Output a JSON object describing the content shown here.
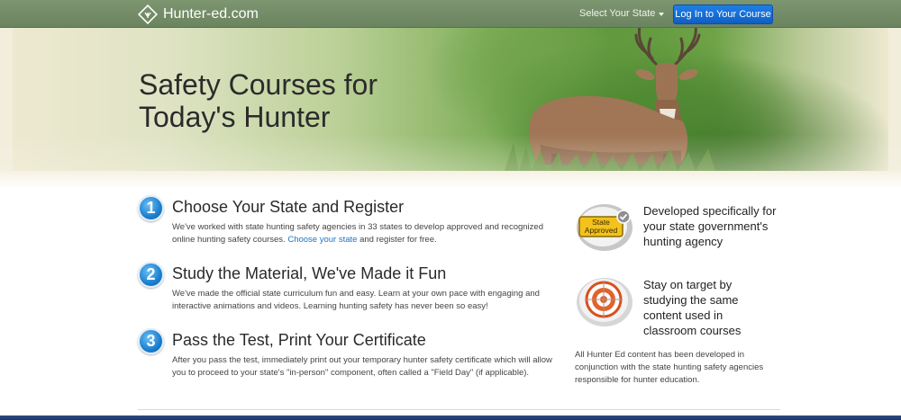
{
  "nav": {
    "logo_text": "Hunter-ed.com",
    "state_select_label": "Select Your State",
    "login_label": "Log In to Your Course"
  },
  "hero": {
    "title_line1": "Safety Courses for",
    "title_line2": "Today's Hunter"
  },
  "steps": [
    {
      "number": "1",
      "title": "Choose Your State and Register",
      "body_before": "We've worked with state hunting safety agencies in 33 states to develop approved and recognized online hunting safety courses. ",
      "link": "Choose your state",
      "body_after": " and register for free."
    },
    {
      "number": "2",
      "title": "Study the Material, We've Made it Fun",
      "body": "We've made the official state curriculum fun and easy. Learn at your own pace with engaging and interactive animations and videos. Learning hunting safety has never been so easy!"
    },
    {
      "number": "3",
      "title": "Pass the Test, Print Your Certificate",
      "body": "After you pass the test, immediately print out your temporary hunter safety certificate which will allow you to proceed to your state's \"in-person\" component, often called a \"Field Day\" (if applicable)."
    }
  ],
  "features": [
    {
      "icon": "state-approved-badge-icon",
      "badge_line1": "State",
      "badge_line2": "Approved",
      "text": "Developed specifically for your state government's hunting agency"
    },
    {
      "icon": "target-icon",
      "text": "Stay on target by studying the same content used in classroom courses"
    }
  ],
  "note": "All Hunter Ed content has been developed in conjunction with the state hunting safety agencies responsible for hunter education.",
  "colors": {
    "nav_bg": "#738d67",
    "login_button": "#1570d6",
    "link": "#1c74c4",
    "step_circle": "#1b7fd0"
  }
}
